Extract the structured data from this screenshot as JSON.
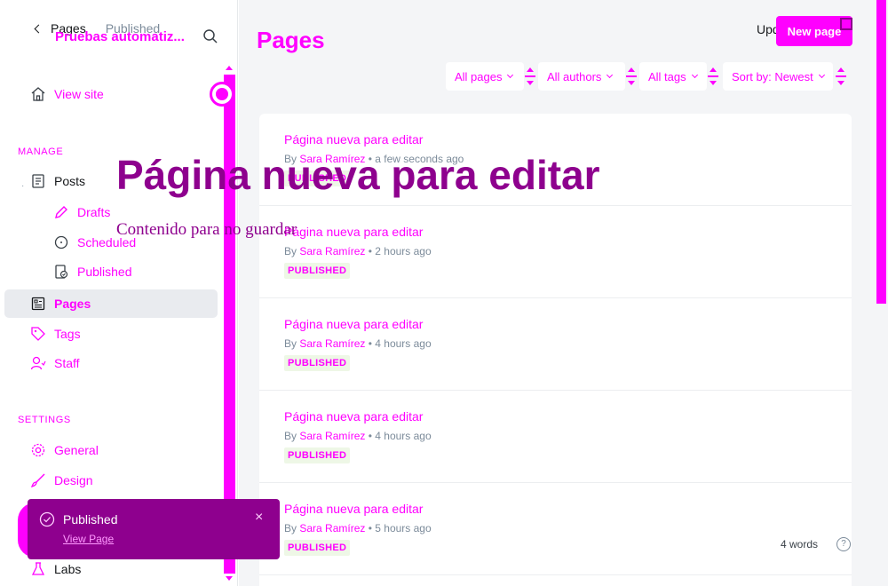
{
  "sidebar": {
    "back_label": "Pages",
    "status": "Published",
    "site_name": "Pruebas automatiz...",
    "view_site": "View site",
    "manage_heading": "MANAGE",
    "posts": "Posts",
    "drafts": "Drafts",
    "scheduled": "Scheduled",
    "published": "Published",
    "pages": "Pages",
    "tags": "Tags",
    "staff": "Staff",
    "settings_heading": "SETTINGS",
    "general": "General",
    "design": "Design",
    "labs": "Labs"
  },
  "toast": {
    "title": "Published",
    "link": "View Page",
    "close": "×"
  },
  "header": {
    "title": "Pages",
    "update_text": "Update",
    "new_page_label": "New page"
  },
  "filters": {
    "all_pages": "All pages",
    "all_authors": "All authors",
    "all_tags": "All tags",
    "sort": "Sort by: Newest"
  },
  "pages": [
    {
      "title": "Página nueva para editar",
      "by": "By",
      "author": "Sara Ramírez",
      "time": "• a few seconds ago",
      "status": "PUBLISHED"
    },
    {
      "title": "Página nueva para editar",
      "by": "By",
      "author": "Sara Ramírez",
      "time": "• 2 hours ago",
      "status": "PUBLISHED"
    },
    {
      "title": "Página nueva para editar",
      "by": "By",
      "author": "Sara Ramírez",
      "time": "• 4 hours ago",
      "status": "PUBLISHED"
    },
    {
      "title": "Página nueva para editar",
      "by": "By",
      "author": "Sara Ramírez",
      "time": "• 4 hours ago",
      "status": "PUBLISHED"
    },
    {
      "title": "Página nueva para editar",
      "by": "By",
      "author": "Sara Ramírez",
      "time": "• 5 hours ago",
      "status": "PUBLISHED"
    }
  ],
  "editor_overlay": {
    "title": "Página nueva para editar",
    "body": "Contenido para no guardar"
  },
  "footer": {
    "word_count": "4 words",
    "help": "?"
  },
  "colors": {
    "accent": "#ff00ff",
    "toast_bg": "#8e008e",
    "overlay_text": "#8e008e",
    "page_bg": "#f4f5f7"
  },
  "icons": [
    "back-chevron-icon",
    "search-icon",
    "home-icon",
    "posts-icon",
    "pencil-icon",
    "clock-icon",
    "published-doc-icon",
    "pages-icon",
    "tag-icon",
    "staff-icon",
    "gear-icon",
    "brush-icon",
    "flask-icon",
    "check-circle-icon",
    "close-icon",
    "help-icon"
  ]
}
